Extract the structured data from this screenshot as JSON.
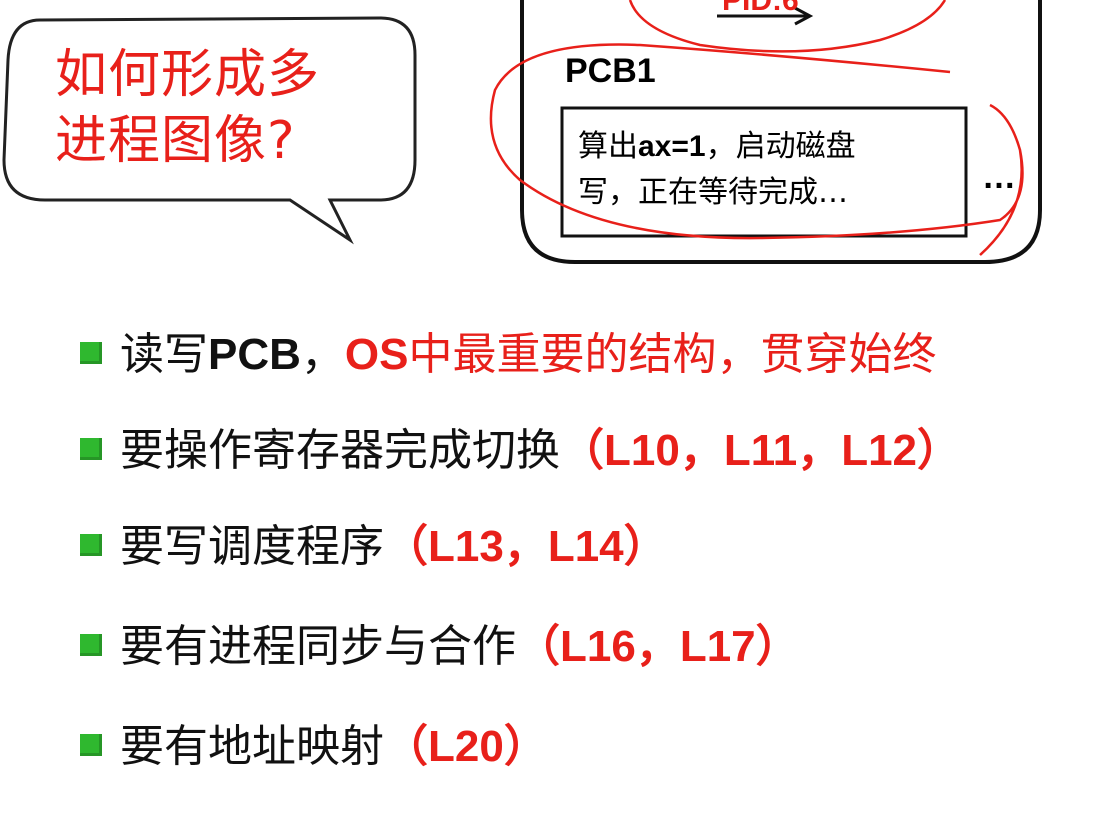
{
  "bubble": {
    "line1": "如何形成多",
    "line2": "进程图像?"
  },
  "pcb": {
    "title": "PCB1",
    "inner_line1_prefix": "算出",
    "inner_line1_bold": "ax=1",
    "inner_line1_suffix": "，启动磁盘",
    "inner_line2": "写，正在等待完成…",
    "ellipsis": "…"
  },
  "bullets": {
    "b1_black": "读写",
    "b1_bold": "PCB",
    "b1_comma": "，",
    "b1_red_bold": "OS",
    "b1_red": "中最重要的结构，贯穿始终",
    "b2_black": "要操作寄存器完成切换",
    "b2_red": "（L10，L11，L12）",
    "b3_black": "要写调度程序",
    "b3_red": "（L13，L14）",
    "b4_black": "要有进程同步与合作",
    "b4_red": "（L16，L17）",
    "b5_black": "要有地址映射",
    "b5_red": "（L20）"
  },
  "colors": {
    "red": "#e8201a",
    "bullet_green": "#2fb82f"
  }
}
